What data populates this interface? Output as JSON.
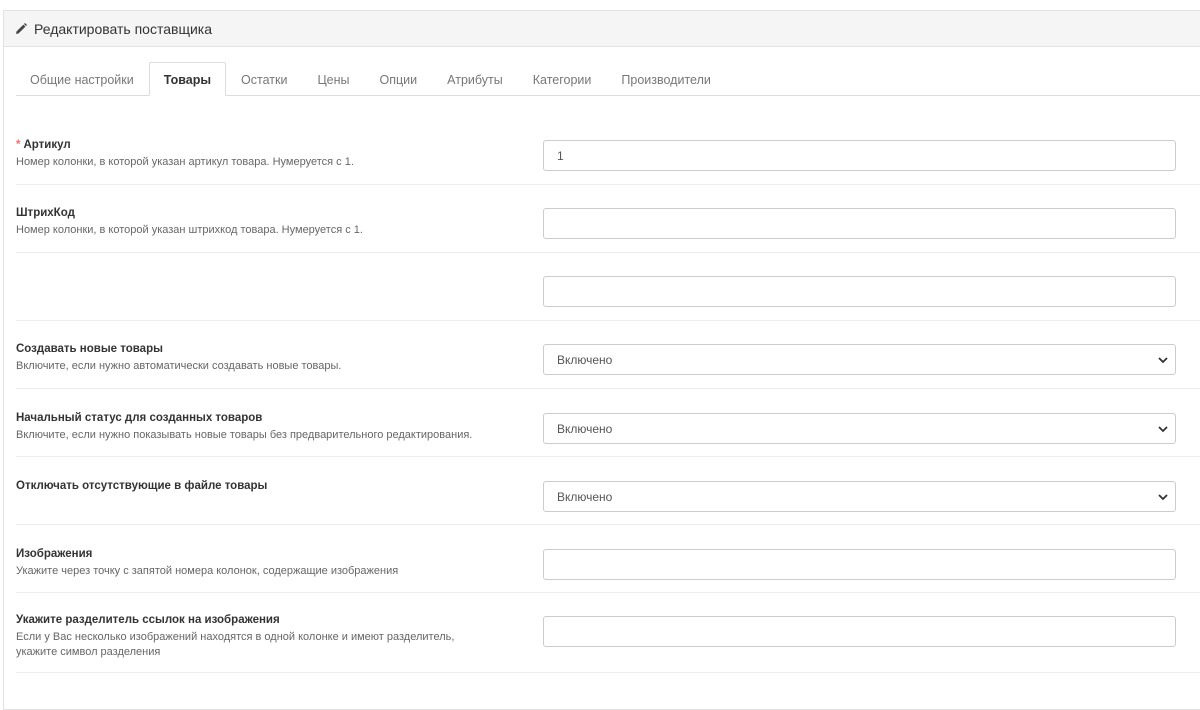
{
  "header": {
    "title": "Редактировать поставщика",
    "icon": "pencil-icon"
  },
  "tabs": [
    {
      "label": "Общие настройки",
      "active": false
    },
    {
      "label": "Товары",
      "active": true
    },
    {
      "label": "Остатки",
      "active": false
    },
    {
      "label": "Цены",
      "active": false
    },
    {
      "label": "Опции",
      "active": false
    },
    {
      "label": "Атрибуты",
      "active": false
    },
    {
      "label": "Категории",
      "active": false
    },
    {
      "label": "Производители",
      "active": false
    }
  ],
  "fields": {
    "sku": {
      "required_mark": "*",
      "label": "Артикул",
      "help": "Номер колонки, в которой указан артикул товара. Нумеруется с 1.",
      "value": "1"
    },
    "barcode": {
      "label": "ШтрихКод",
      "help": "Номер колонки, в которой указан штрихкод товара. Нумеруется с 1.",
      "value": ""
    },
    "unnamed": {
      "value": ""
    },
    "create_new": {
      "label": "Создавать новые товары",
      "help": "Включите, если нужно автоматически создавать новые товары.",
      "value": "Включено"
    },
    "initial_status": {
      "label": "Начальный статус для созданных товаров",
      "help": "Включите, если нужно показывать новые товары без предварительного редактирования.",
      "value": "Включено"
    },
    "disable_missing": {
      "label": "Отключать отсутствующие в файле товары",
      "value": "Включено"
    },
    "images": {
      "label": "Изображения",
      "help": "Укажите через точку с запятой номера колонок, содержащие изображения",
      "value": ""
    },
    "image_separator": {
      "label": "Укажите разделитель ссылок на изображения",
      "help_line1": "Если у Вас несколько изображений находятся в одной колонке и имеют разделитель,",
      "help_line2": "укажите символ разделения",
      "value": ""
    }
  }
}
